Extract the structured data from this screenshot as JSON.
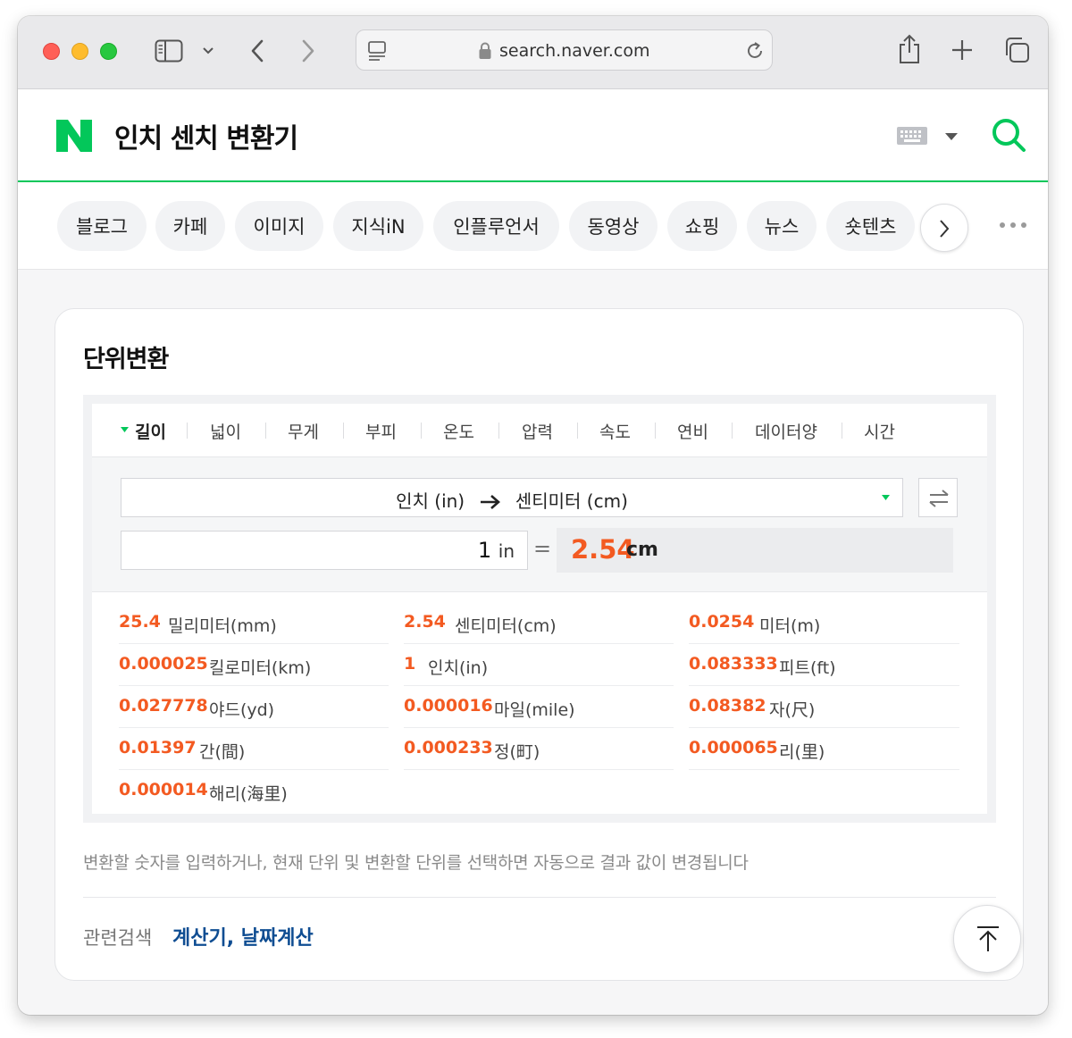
{
  "browser": {
    "url": "search.naver.com"
  },
  "header": {
    "query": "인치 센치 변환기"
  },
  "search_tabs": [
    "블로그",
    "카페",
    "이미지",
    "지식iN",
    "인플루언서",
    "동영상",
    "쇼핑",
    "뉴스",
    "숏텐츠"
  ],
  "converter": {
    "title": "단위변환",
    "categories": [
      "길이",
      "넓이",
      "무게",
      "부피",
      "온도",
      "압력",
      "속도",
      "연비",
      "데이터양",
      "시간"
    ],
    "active_category": "길이",
    "from_unit": "인치 (in)",
    "to_unit": "센티미터 (cm)",
    "input_value": "1",
    "input_unit": "in",
    "equals": "=",
    "result_value": "2.54",
    "result_unit": "cm",
    "results": [
      {
        "value": "25.4",
        "unit": "밀리미터(mm)"
      },
      {
        "value": "2.54",
        "unit": "센티미터(cm)"
      },
      {
        "value": "0.0254",
        "unit": "미터(m)"
      },
      {
        "value": "0.000025",
        "unit": "킬로미터(km)"
      },
      {
        "value": "1",
        "unit": "인치(in)"
      },
      {
        "value": "0.083333",
        "unit": "피트(ft)"
      },
      {
        "value": "0.027778",
        "unit": "야드(yd)"
      },
      {
        "value": "0.000016",
        "unit": "마일(mile)"
      },
      {
        "value": "0.08382",
        "unit": "자(尺)"
      },
      {
        "value": "0.01397",
        "unit": "간(間)"
      },
      {
        "value": "0.000233",
        "unit": "정(町)"
      },
      {
        "value": "0.000065",
        "unit": "리(里)"
      },
      {
        "value": "0.000014",
        "unit": "해리(海里)"
      }
    ],
    "note": "변환할 숫자를 입력하거나, 현재 단위 및 변환할 단위를 선택하면 자동으로 결과 값이 변경됩니다"
  },
  "related": {
    "label": "관련검색",
    "links": [
      "계산기",
      "날짜계산"
    ],
    "separator": ","
  },
  "colors": {
    "naver_green": "#03c75a",
    "result_orange": "#f35a21",
    "link_blue": "#0f4d92"
  },
  "icons": [
    "sidebar-icon",
    "chevron-down-icon",
    "back-icon",
    "forward-icon",
    "reader-icon",
    "lock-icon",
    "reload-icon",
    "share-icon",
    "plus-icon",
    "tabs-icon",
    "keyboard-icon",
    "search-icon",
    "chevron-right-icon",
    "more-icon",
    "swap-icon",
    "arrow-right-icon",
    "arrow-up-icon"
  ]
}
